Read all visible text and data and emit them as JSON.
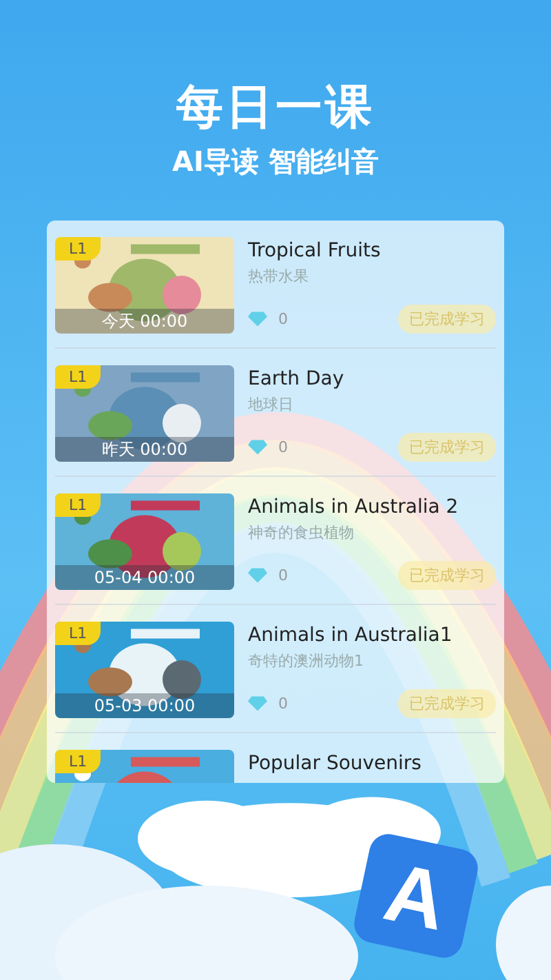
{
  "header": {
    "title": "每日一课",
    "subtitle": "AI导读 智能纠音"
  },
  "lessons": [
    {
      "level": "L1",
      "title": "Tropical Fruits",
      "subtitle": "热带水果",
      "date": "今天 00:00",
      "gems": "0",
      "status": "已完成学习"
    },
    {
      "level": "L1",
      "title": "Earth Day",
      "subtitle": "地球日",
      "date": "昨天 00:00",
      "gems": "0",
      "status": "已完成学习"
    },
    {
      "level": "L1",
      "title": "Animals in Australia 2",
      "subtitle": "神奇的食虫植物",
      "date": "05-04 00:00",
      "gems": "0",
      "status": "已完成学习"
    },
    {
      "level": "L1",
      "title": "Animals in Australia1",
      "subtitle": "奇特的澳洲动物1",
      "date": "05-03 00:00",
      "gems": "0",
      "status": "已完成学习"
    },
    {
      "level": "L1",
      "title": "Popular Souvenirs"
    }
  ],
  "logo": "A"
}
